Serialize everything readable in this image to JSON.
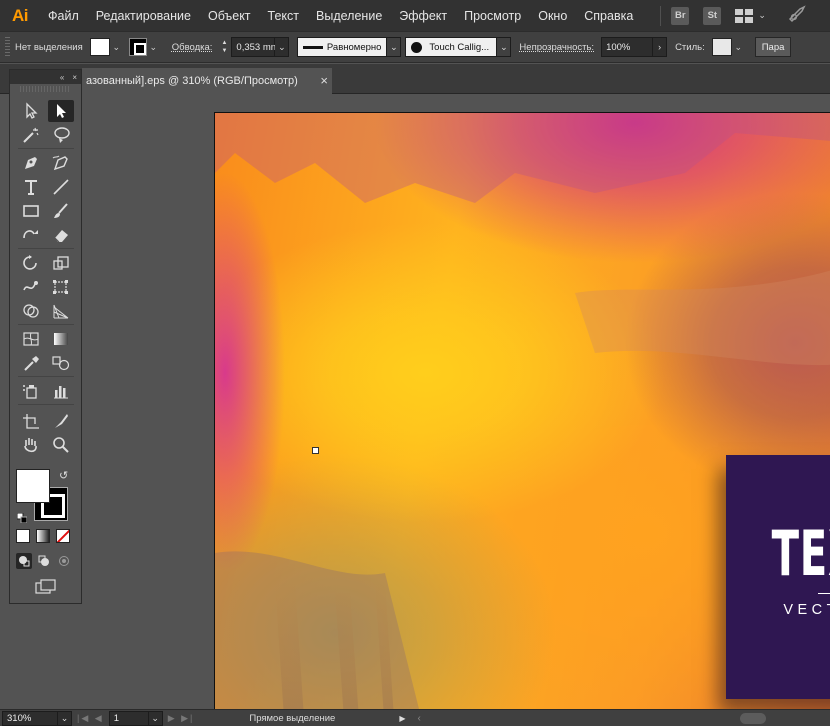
{
  "menubar": {
    "logo": "Ai",
    "items": [
      "Файл",
      "Редактирование",
      "Объект",
      "Текст",
      "Выделение",
      "Эффект",
      "Просмотр",
      "Окно",
      "Справка"
    ],
    "badges": [
      "Br",
      "St"
    ]
  },
  "controlbar": {
    "selection_label": "Нет выделения",
    "stroke_label": "Обводка:",
    "stroke_value": "0,353 mn",
    "profile_value": "Равномерно",
    "brush_value": "Touch Callig...",
    "opacity_label": "Непрозрачность:",
    "opacity_value": "100%",
    "style_label": "Стиль:",
    "paragraph_button": "Пара"
  },
  "document_tab": {
    "title": "азованный].eps @ 310% (RGB/Просмотр)",
    "close": "×"
  },
  "artwork": {
    "title": "TEXTURE",
    "subtitle": "VECTOR GRUNGE",
    "card_color": "#2f1752"
  },
  "statusbar": {
    "zoom": "310%",
    "artboard_number": "1",
    "tool_name": "Прямое выделение"
  },
  "colors": {
    "accent_orange": "#ff9a00",
    "app_bg": "#535353",
    "menubar_bg": "#323232"
  }
}
